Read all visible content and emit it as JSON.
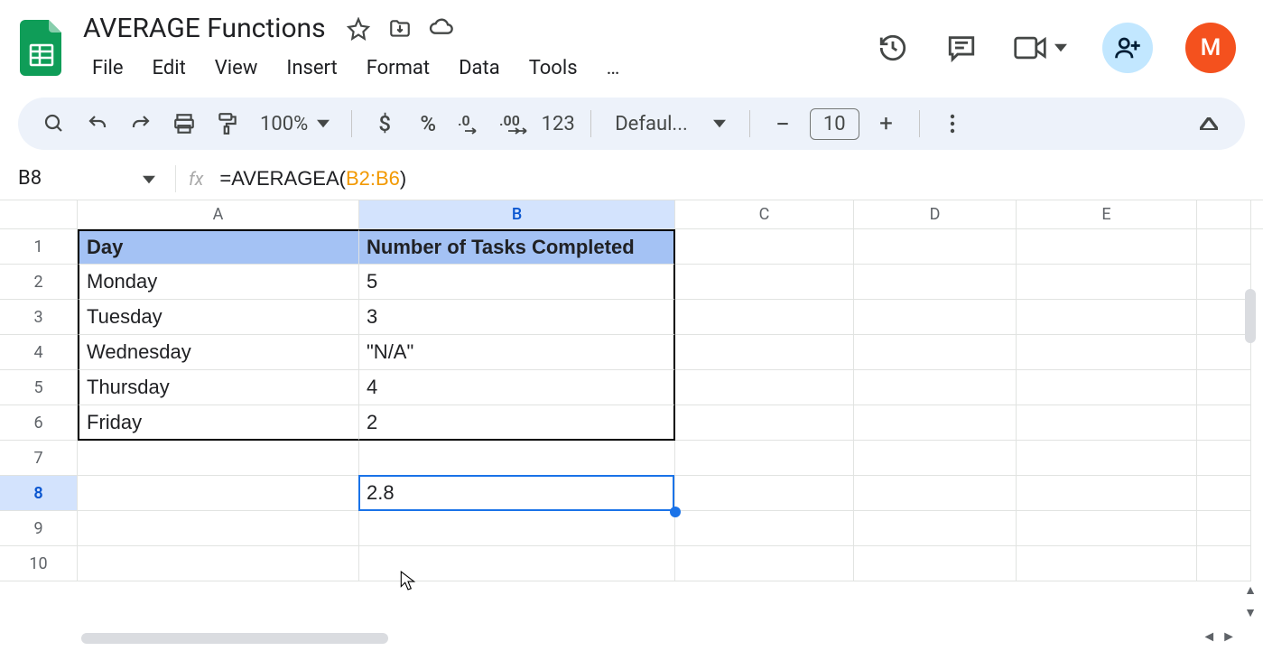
{
  "doc": {
    "title": "AVERAGE Functions",
    "avatar_letter": "M"
  },
  "menubar": {
    "items": [
      "File",
      "Edit",
      "View",
      "Insert",
      "Format",
      "Data",
      "Tools"
    ],
    "overflow": "…"
  },
  "toolbar": {
    "zoom": "100%",
    "font": "Defaul...",
    "font_size": "10",
    "number_format": "123"
  },
  "formula_bar": {
    "name_box": "B8",
    "formula_prefix": "=AVERAGEA(",
    "formula_range": "B2:B6",
    "formula_suffix": ")"
  },
  "columns": [
    "A",
    "B",
    "C",
    "D",
    "E"
  ],
  "rows": [
    "1",
    "2",
    "3",
    "4",
    "5",
    "6",
    "7",
    "8",
    "9",
    "10"
  ],
  "cells": {
    "A1": "Day",
    "B1": "Number of Tasks Completed",
    "A2": "Monday",
    "B2": "5",
    "A3": "Tuesday",
    "B3": "3",
    "A4": "Wednesday",
    "B4": "\"N/A\"",
    "A5": "Thursday",
    "B5": "4",
    "A6": "Friday",
    "B6": "2",
    "B8": "2.8"
  },
  "active_cell": "B8"
}
